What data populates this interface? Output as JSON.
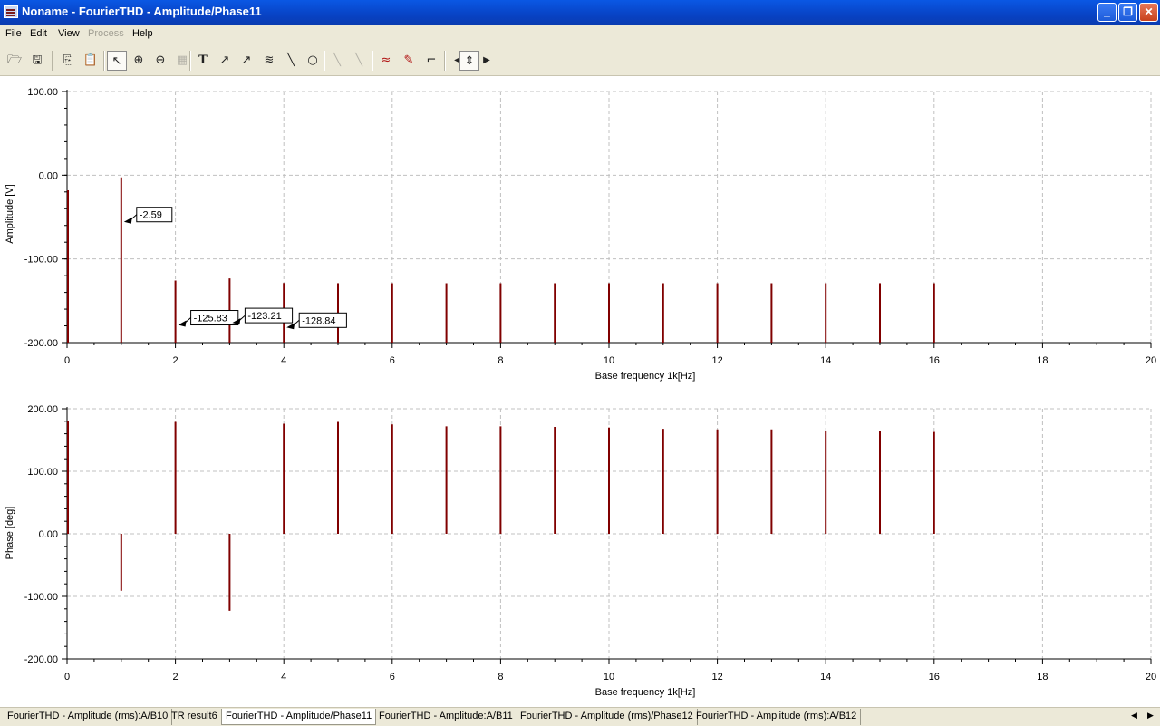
{
  "window": {
    "title": "Noname - FourierTHD - Amplitude/Phase11",
    "controls": {
      "minimize": "_",
      "restore": "❐",
      "close": "✕"
    }
  },
  "menu": [
    {
      "label": "File",
      "enabled": true
    },
    {
      "label": "Edit",
      "enabled": true
    },
    {
      "label": "View",
      "enabled": true
    },
    {
      "label": "Process",
      "enabled": false
    },
    {
      "label": "Help",
      "enabled": true
    }
  ],
  "toolbar": {
    "icons": [
      "open-icon",
      "save-icon",
      "copy-icon",
      "paste-icon",
      "pointer-icon",
      "zoom-in-icon",
      "zoom-out-icon",
      "grid-icon",
      "text-icon",
      "curve-label-icon",
      "curve-label-alt-icon",
      "legend-icon",
      "line-icon",
      "circle-icon",
      "diagonal-line-icon",
      "diagonal-line-alt-icon",
      "add-curve-icon",
      "cursor-probe-icon",
      "marker-icon",
      "step-left-icon",
      "step-up-down-icon",
      "step-right-icon"
    ],
    "glyphs": {
      "open": "🗁",
      "save": "🖫",
      "copy": "⎘",
      "paste": "📋",
      "pointer": "↖",
      "zoom_in": "⊕",
      "zoom_out": "⊖",
      "grid": "▦",
      "text": "T",
      "curve_label": "↗",
      "curve_label_alt": "↗",
      "legend": "≋",
      "line": "╲",
      "circle": "○",
      "diag1": "╲",
      "diag2": "╲",
      "add_curve": "≈",
      "probe": "✎",
      "marker": "⌐",
      "left": "◀",
      "updown": "⇕",
      "right": "▶"
    }
  },
  "tabs": [
    "FourierTHD - Amplitude (rms):A/B10",
    "TR result6",
    "FourierTHD - Amplitude/Phase11",
    "FourierTHD - Amplitude:A/B11",
    "FourierTHD - Amplitude (rms)/Phase12",
    "FourierTHD - Amplitude (rms):A/B12"
  ],
  "active_tab": 2,
  "scroll": {
    "left": "◀",
    "right": "▶"
  },
  "colors": {
    "series": "#800000",
    "grid": "#c0c0c0",
    "menu_bg": "#ece9d8",
    "title_bg": "#0842c4"
  },
  "chart_data": [
    {
      "type": "bar",
      "xlabel": "Base frequency 1k[Hz]",
      "ylabel": "Amplitude [V]",
      "xlim": [
        0,
        20
      ],
      "ylim": [
        -200,
        100
      ],
      "x_ticks": [
        "0",
        "2",
        "4",
        "6",
        "8",
        "10",
        "12",
        "14",
        "16",
        "18",
        "20"
      ],
      "y_ticks": [
        "100.00",
        "0.00",
        "-100.00",
        "-200.00"
      ],
      "grid": true,
      "baseline": -200,
      "x": [
        0,
        1,
        2,
        3,
        4,
        5,
        6,
        7,
        8,
        9,
        10,
        11,
        12,
        13,
        14,
        15,
        16
      ],
      "values": [
        -18,
        -2.59,
        -125.83,
        -123.21,
        -128.84,
        -129,
        -129,
        -129,
        -129,
        -129,
        -129,
        -129,
        -129,
        -129,
        -129,
        -129,
        -129
      ],
      "annotations": [
        {
          "x": 1,
          "y": -2.59,
          "text": "-2.59"
        },
        {
          "x": 2,
          "y": -125.83,
          "text": "-125.83"
        },
        {
          "x": 3,
          "y": -123.21,
          "text": "-123.21"
        },
        {
          "x": 4,
          "y": -128.84,
          "text": "-128.84"
        }
      ]
    },
    {
      "type": "bar",
      "xlabel": "Base frequency 1k[Hz]",
      "ylabel": "Phase [deg]",
      "xlim": [
        0,
        20
      ],
      "ylim": [
        -200,
        200
      ],
      "x_ticks": [
        "0",
        "2",
        "4",
        "6",
        "8",
        "10",
        "12",
        "14",
        "16",
        "18",
        "20"
      ],
      "y_ticks": [
        "200.00",
        "100.00",
        "0.00",
        "-100.00",
        "-200.00"
      ],
      "grid": true,
      "baseline": 0,
      "x": [
        0,
        1,
        2,
        3,
        4,
        5,
        6,
        7,
        8,
        9,
        10,
        11,
        12,
        13,
        14,
        15,
        16
      ],
      "values": [
        180,
        -91,
        179,
        -123,
        176,
        179,
        175,
        172,
        172,
        171,
        170,
        168,
        167,
        167,
        165,
        164,
        163
      ],
      "annotations": []
    }
  ]
}
